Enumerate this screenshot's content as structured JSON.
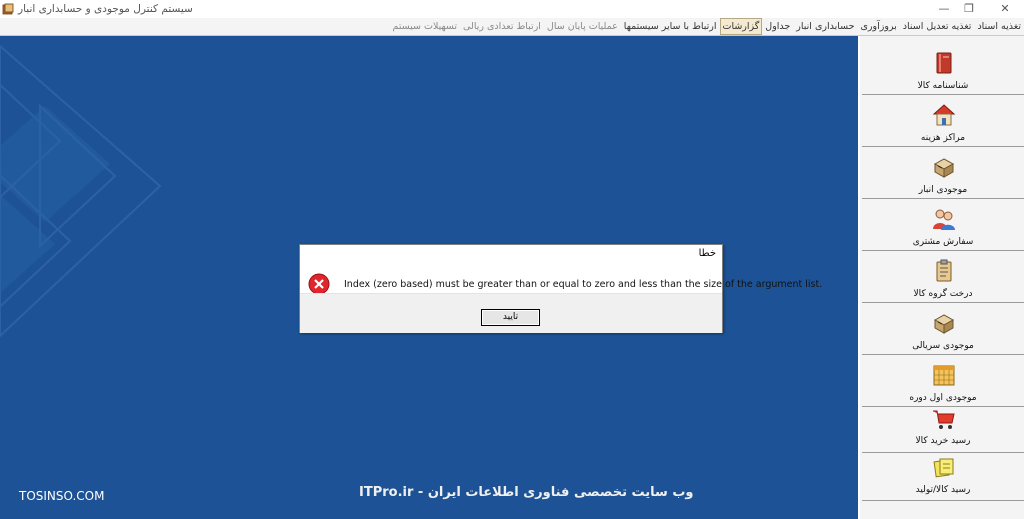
{
  "window": {
    "title": "سیستم کنترل موجودی و حسابداری انبار",
    "icons": {
      "app": "ledger-app-icon",
      "minimize": "minimize-icon",
      "maximize": "restore-icon",
      "close": "close-icon"
    }
  },
  "menu": {
    "items": [
      {
        "label": "تغذیه اسناد",
        "state": "normal"
      },
      {
        "label": "تغذیه تعدیل اسناد",
        "state": "normal"
      },
      {
        "label": "بروزآوری",
        "state": "normal"
      },
      {
        "label": "حسابداری انبار",
        "state": "normal"
      },
      {
        "label": "جداول",
        "state": "normal"
      },
      {
        "label": "گزارشات",
        "state": "active"
      },
      {
        "label": "ارتباط با سایر سیستمها",
        "state": "normal"
      },
      {
        "label": "عملیات پایان سال",
        "state": "muted"
      },
      {
        "label": "ارتباط تعدادی ریالی",
        "state": "muted"
      },
      {
        "label": "تسهیلات سیستم",
        "state": "muted"
      }
    ]
  },
  "sidebar": {
    "items": [
      {
        "label": "شناسنامه کالا",
        "icon": "book-icon"
      },
      {
        "label": "مراکز هزینه",
        "icon": "house-icon"
      },
      {
        "label": "موجودی انبار",
        "icon": "boxes-icon"
      },
      {
        "label": "سفارش مشتری",
        "icon": "people-icon"
      },
      {
        "label": "درخت گروه کالا",
        "icon": "clipboard-icon"
      },
      {
        "label": "موجودی سریالی",
        "icon": "boxes-icon"
      },
      {
        "label": "موجودی اول دوره",
        "icon": "calendar-icon"
      },
      {
        "label": "رسید خرید کالا",
        "icon": "cart-icon"
      },
      {
        "label": "رسید کالا/تولید",
        "icon": "notes-icon"
      }
    ]
  },
  "dialog": {
    "title": "خطا",
    "icon": "error-icon",
    "message": "Index (zero based) must be greater than or equal to zero and less than the size of the argument list.",
    "ok_label": "تایید"
  },
  "watermarks": {
    "left": "TOSINSO.COM",
    "center": "ITPro.ir - وب سایت تخصصی فناوری اطلاعات ایران"
  },
  "colors": {
    "desktop": "#1d5396",
    "error": "#e0252d",
    "menu_active": "#f4ead0"
  }
}
